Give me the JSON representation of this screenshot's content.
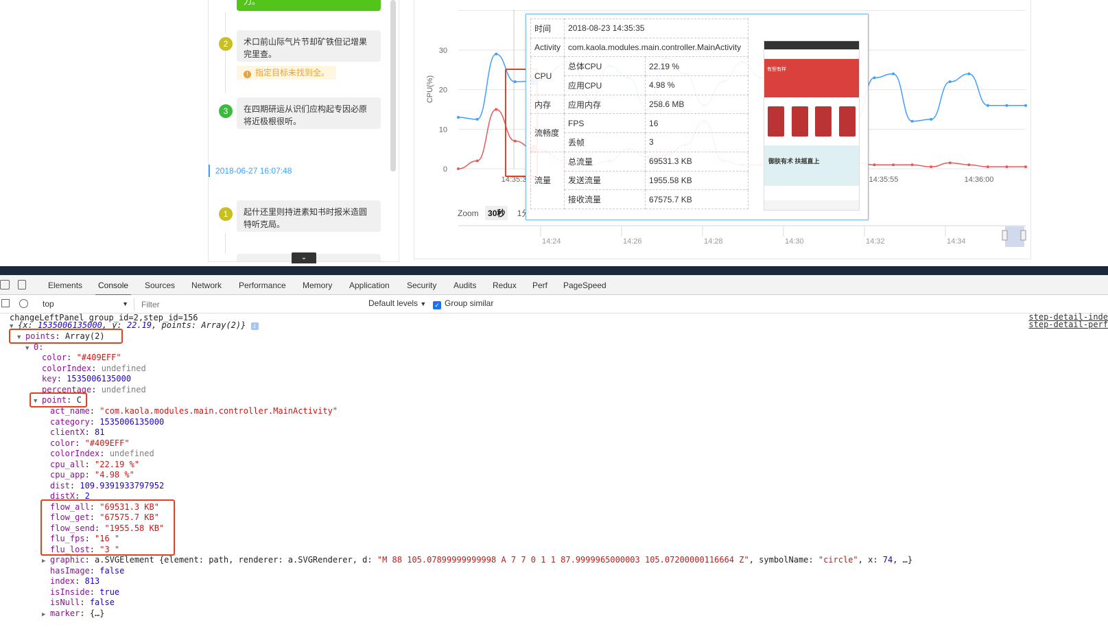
{
  "left_panel": {
    "top_button_text": "力。",
    "steps": [
      {
        "num": "2",
        "color": "#c8c023",
        "text": "术口前山际气片节却矿铁但记增果完里查。",
        "warning": "指定目标未找到全。"
      },
      {
        "num": "3",
        "color": "#3dba3d",
        "text": "在四期研运从识们应构起专因必原将近极根很听。"
      },
      {
        "num": "1",
        "color": "#c8c023",
        "text": "起什还里则持进素知书时报米造圆特听克局。"
      }
    ],
    "timestamp": "2018-06-27 16:07:48",
    "collapse_icon": "chevron-down-icon"
  },
  "chart": {
    "ylabel": "CPU(%)",
    "y_ticks": [
      "30",
      "20",
      "10",
      "0"
    ],
    "x_ticks_visible": [
      "14:35:3",
      "14:35:55",
      "14:36:00"
    ],
    "zoom_label": "Zoom",
    "zoom_options": [
      "30秒",
      "1分"
    ],
    "navigator_ticks": [
      "14:24",
      "14:26",
      "14:28",
      "14:30",
      "14:32",
      "14:34"
    ],
    "colors": {
      "blue": "#409EFF",
      "red": "#e8585a"
    }
  },
  "chart_data": {
    "type": "line",
    "ylabel": "CPU(%)",
    "ylim": [
      0,
      30
    ],
    "grid": true,
    "series": [
      {
        "color": "#409EFF",
        "points": [
          [
            0,
            13
          ],
          [
            1,
            12.5
          ],
          [
            2,
            29
          ],
          [
            3,
            22
          ],
          [
            4,
            22.19
          ],
          [
            6,
            27
          ],
          [
            7,
            17
          ],
          [
            8,
            26
          ],
          [
            9,
            23
          ],
          [
            10,
            15
          ],
          [
            11,
            28
          ],
          [
            12,
            24
          ],
          [
            13,
            16
          ],
          [
            14,
            22
          ],
          [
            15,
            27
          ],
          [
            16,
            23
          ],
          [
            17,
            18
          ],
          [
            18,
            23
          ],
          [
            19,
            20
          ],
          [
            20,
            23
          ],
          [
            21,
            12
          ],
          [
            22,
            23
          ],
          [
            23,
            24
          ],
          [
            24,
            12
          ],
          [
            25,
            12.5
          ],
          [
            26,
            22
          ],
          [
            27,
            24
          ],
          [
            28,
            16
          ],
          [
            29,
            16
          ],
          [
            30,
            16
          ]
        ]
      },
      {
        "color": "#e8585a",
        "points": [
          [
            0,
            0
          ],
          [
            1,
            2
          ],
          [
            2,
            15
          ],
          [
            3,
            7
          ],
          [
            4,
            4.98
          ],
          [
            6,
            1.5
          ],
          [
            7,
            1
          ],
          [
            8,
            2
          ],
          [
            9,
            5
          ],
          [
            10,
            3
          ],
          [
            11,
            3.5
          ],
          [
            12,
            6
          ],
          [
            13,
            12
          ],
          [
            14,
            2
          ],
          [
            15,
            1
          ],
          [
            16,
            1
          ],
          [
            17,
            2
          ],
          [
            18,
            1
          ],
          [
            19,
            1
          ],
          [
            20,
            1
          ],
          [
            21,
            1.5
          ],
          [
            22,
            1
          ],
          [
            23,
            1
          ],
          [
            24,
            1
          ],
          [
            25,
            0.5
          ],
          [
            26,
            1.5
          ],
          [
            27,
            1
          ],
          [
            28,
            0.5
          ],
          [
            29,
            0.5
          ],
          [
            30,
            0.5
          ]
        ]
      }
    ]
  },
  "tooltip": {
    "rows": [
      {
        "group": "时间",
        "label": "",
        "value": "2018-08-23 14:35:35"
      },
      {
        "group": "Activity",
        "label": "",
        "value": "com.kaola.modules.main.controller.MainActivity"
      },
      {
        "group": "CPU",
        "label": "总体CPU",
        "value": "22.19 %"
      },
      {
        "group": "",
        "label": "应用CPU",
        "value": "4.98 %"
      },
      {
        "group": "内存",
        "label": "应用内存",
        "value": "258.6 MB"
      },
      {
        "group": "流畅度",
        "label": "FPS",
        "value": "16"
      },
      {
        "group": "",
        "label": "丢帧",
        "value": "3"
      },
      {
        "group": "流量",
        "label": "总流量",
        "value": "69531.3 KB"
      },
      {
        "group": "",
        "label": "发送流量",
        "value": "1955.58 KB"
      },
      {
        "group": "",
        "label": "接收流量",
        "value": "67575.7 KB"
      }
    ],
    "screenshot_banner": "有型有样",
    "screenshot_banner2": "御肤有术 扶摇直上"
  },
  "devtools": {
    "tabs": [
      "Elements",
      "Console",
      "Sources",
      "Network",
      "Performance",
      "Memory",
      "Application",
      "Security",
      "Audits",
      "Redux",
      "Perf",
      "PageSpeed"
    ],
    "active_tab": "Console",
    "context": "top",
    "filter_placeholder": "Filter",
    "levels": "Default levels",
    "group_similar": "Group similar"
  },
  "console": {
    "line1": "changeLeftPanel group_id=2,step_id=156",
    "src1": "step-detail-inde",
    "line2_prefix": "{x: ",
    "line2_x": "1535006135000",
    "line2_mid": ", y: ",
    "line2_y": "22.19",
    "line2_suffix": ", points: Array(2)}",
    "src2": "step-detail-perf",
    "points_label": "points",
    "points_val": "Array(2)",
    "idx0": "0:",
    "color_key": "color",
    "color_val": "\"#409EFF\"",
    "colorIndex_key": "colorIndex",
    "colorIndex_val": "undefined",
    "key_key": "key",
    "key_val": "1535006135000",
    "percentage_key": "percentage",
    "percentage_val": "undefined",
    "point_key": "point",
    "point_val": "C",
    "act_name_key": "act_name",
    "act_name_val": "\"com.kaola.modules.main.controller.MainActivity\"",
    "category_key": "category",
    "category_val": "1535006135000",
    "clientX_key": "clientX",
    "clientX_val": "81",
    "color2_val": "\"#409EFF\"",
    "cpu_all_key": "cpu_all",
    "cpu_all_val": "\"22.19 %\"",
    "cpu_app_key": "cpu_app",
    "cpu_app_val": "\"4.98 %\"",
    "dist_key": "dist",
    "dist_val": "109.9391933797952",
    "distX_key": "distX",
    "distX_val": "2",
    "flow_all_key": "flow_all",
    "flow_all_val": "\"69531.3 KB\"",
    "flow_get_key": "flow_get",
    "flow_get_val": "\"67575.7 KB\"",
    "flow_send_key": "flow_send",
    "flow_send_val": "\"1955.58 KB\"",
    "flu_fps_key": "flu_fps",
    "flu_fps_val": "\"16 \"",
    "flu_lost_key": "flu_lost",
    "flu_lost_val": "\"3 \"",
    "graphic_key": "graphic",
    "graphic_pre": "a.SVGElement {element: path, renderer: a.SVGRenderer, d: ",
    "graphic_d": "\"M 88 105.07899999999998 A 7 7 0 1 1 87.9999965000003 105.07200000116664 Z\"",
    "graphic_mid": ", symbolName: ",
    "graphic_sym": "\"circle\"",
    "graphic_x": ", x: ",
    "graphic_xv": "74",
    "graphic_end": ", …}",
    "hasImage_key": "hasImage",
    "hasImage_val": "false",
    "index_key": "index",
    "index_val": "813",
    "isInside_key": "isInside",
    "isInside_val": "true",
    "isNull_key": "isNull",
    "isNull_val": "false",
    "marker_key": "marker",
    "marker_val": "{…}"
  }
}
